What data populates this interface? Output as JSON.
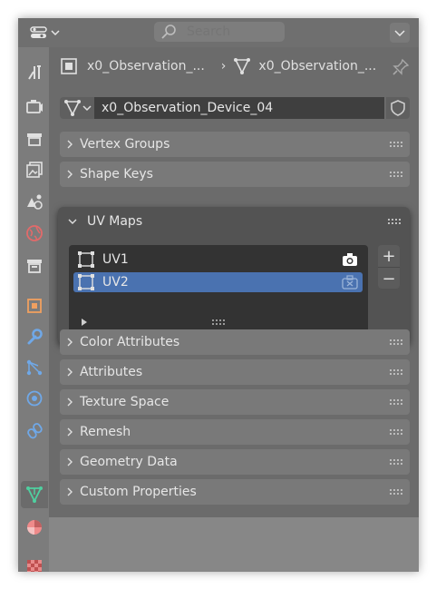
{
  "search": {
    "placeholder": "Search"
  },
  "breadcrumb": {
    "object": "x0_Observation_...",
    "mesh": "x0_Observation_..."
  },
  "datablock": {
    "name": "x0_Observation_Device_04"
  },
  "panels": [
    {
      "title": "Vertex Groups"
    },
    {
      "title": "Shape Keys"
    },
    {
      "title": "UV Maps"
    },
    {
      "title": "Color Attributes"
    },
    {
      "title": "Attributes"
    },
    {
      "title": "Texture Space"
    },
    {
      "title": "Remesh"
    },
    {
      "title": "Geometry Data"
    },
    {
      "title": "Custom Properties"
    }
  ],
  "uv_maps": {
    "items": [
      "UV1",
      "UV2"
    ],
    "selected": "UV2",
    "add": "+",
    "remove": "−"
  },
  "tabs": [
    "tool",
    "render",
    "output",
    "view-layer",
    "scene",
    "world",
    "collection",
    "object",
    "modifiers",
    "particles",
    "physics",
    "constraints",
    "data",
    "material",
    "texture"
  ],
  "active_tab": "data",
  "colors": {
    "accent_green": "#4fd0a0",
    "selection_blue": "#4a72b0"
  }
}
